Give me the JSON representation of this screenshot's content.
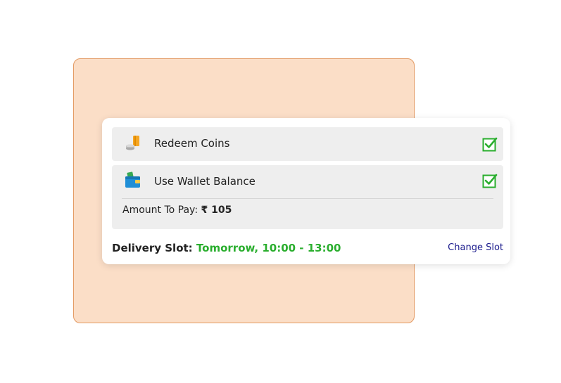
{
  "colors": {
    "background_panel": "#fbdec7",
    "background_panel_border": "#e39a63",
    "row_background": "#eeeeee",
    "check_green": "#2aae2e",
    "slot_green": "#2aae2e",
    "link_blue": "#1a1a8c"
  },
  "coins": {
    "icon": "coins-icon",
    "label": "Redeem Coins",
    "checked": true
  },
  "wallet": {
    "icon": "wallet-icon",
    "label": "Use Wallet Balance",
    "checked": true
  },
  "amount": {
    "label": "Amount To Pay:",
    "value": "₹ 105"
  },
  "delivery": {
    "label": "Delivery Slot:",
    "slot": "Tomorrow, 10:00 - 13:00",
    "change_label": "Change Slot"
  }
}
